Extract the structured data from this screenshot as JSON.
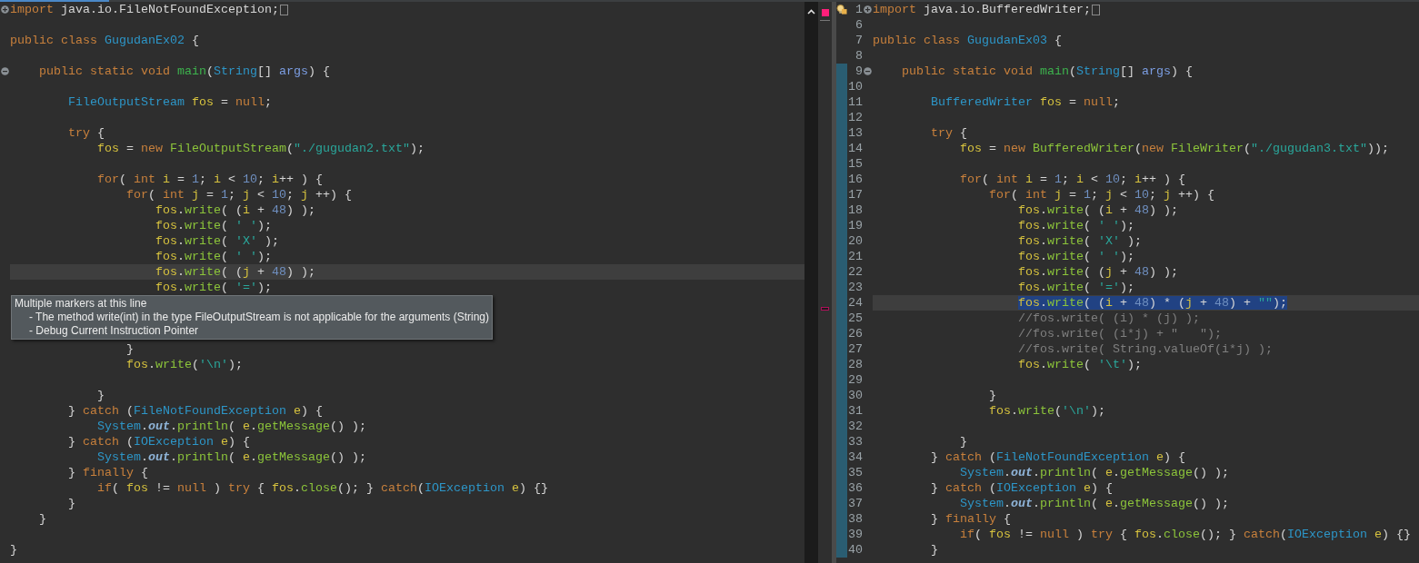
{
  "left_editor": {
    "tab": {
      "selected": true
    },
    "error_indicator": true,
    "lines": [
      {
        "kind": "code",
        "folded": true,
        "collapsed_block": true,
        "tokens": [
          {
            "text": "import",
            "kind": "keyword"
          },
          {
            "text": " java.io.FileNotFoundException;",
            "kind": "plain"
          }
        ]
      },
      {
        "kind": "blank"
      },
      {
        "kind": "code",
        "tokens": [
          {
            "text": "public class ",
            "kind": "keyword"
          },
          {
            "text": "GugudanEx02",
            "kind": "type"
          },
          {
            "text": " {",
            "kind": "plain"
          }
        ]
      },
      {
        "kind": "blank"
      },
      {
        "kind": "code",
        "folded": false,
        "tokens": [
          {
            "text": "    public static void ",
            "kind": "keyword"
          },
          {
            "text": "main",
            "kind": "main"
          },
          {
            "text": "(",
            "kind": "plain"
          },
          {
            "text": "String",
            "kind": "type"
          },
          {
            "text": "[] ",
            "kind": "plain"
          },
          {
            "text": "args",
            "kind": "param"
          },
          {
            "text": ") {",
            "kind": "plain"
          }
        ]
      },
      {
        "kind": "blank"
      },
      {
        "kind": "code",
        "tokens": [
          {
            "text": "        FileOutputStream ",
            "kind": "type"
          },
          {
            "text": "fos",
            "kind": "variable"
          },
          {
            "text": " = ",
            "kind": "plain"
          },
          {
            "text": "null",
            "kind": "keyword"
          },
          {
            "text": ";",
            "kind": "plain"
          }
        ]
      },
      {
        "kind": "blank"
      },
      {
        "kind": "code",
        "tokens": [
          {
            "text": "        try",
            "kind": "keyword"
          },
          {
            "text": " {",
            "kind": "plain"
          }
        ]
      },
      {
        "kind": "code",
        "tokens": [
          {
            "text": "            fos",
            "kind": "variable"
          },
          {
            "text": " = ",
            "kind": "plain"
          },
          {
            "text": "new ",
            "kind": "keyword"
          },
          {
            "text": "FileOutputStream",
            "kind": "method"
          },
          {
            "text": "(",
            "kind": "plain"
          },
          {
            "text": "\"./gugudan2.txt\"",
            "kind": "string"
          },
          {
            "text": ");",
            "kind": "plain"
          }
        ]
      },
      {
        "kind": "blank"
      },
      {
        "kind": "code",
        "tokens": [
          {
            "text": "            for",
            "kind": "keyword"
          },
          {
            "text": "( ",
            "kind": "plain"
          },
          {
            "text": "int ",
            "kind": "keyword"
          },
          {
            "text": "i",
            "kind": "variable"
          },
          {
            "text": " = ",
            "kind": "plain"
          },
          {
            "text": "1",
            "kind": "number"
          },
          {
            "text": "; ",
            "kind": "plain"
          },
          {
            "text": "i",
            "kind": "variable"
          },
          {
            "text": " < ",
            "kind": "plain"
          },
          {
            "text": "10",
            "kind": "number"
          },
          {
            "text": "; ",
            "kind": "plain"
          },
          {
            "text": "i",
            "kind": "variable"
          },
          {
            "text": "++ ) {",
            "kind": "plain"
          }
        ]
      },
      {
        "kind": "code",
        "tokens": [
          {
            "text": "                for",
            "kind": "keyword"
          },
          {
            "text": "( ",
            "kind": "plain"
          },
          {
            "text": "int ",
            "kind": "keyword"
          },
          {
            "text": "j",
            "kind": "variable"
          },
          {
            "text": " = ",
            "kind": "plain"
          },
          {
            "text": "1",
            "kind": "number"
          },
          {
            "text": "; ",
            "kind": "plain"
          },
          {
            "text": "j",
            "kind": "variable"
          },
          {
            "text": " < ",
            "kind": "plain"
          },
          {
            "text": "10",
            "kind": "number"
          },
          {
            "text": "; ",
            "kind": "plain"
          },
          {
            "text": "j",
            "kind": "variable"
          },
          {
            "text": " ++) {",
            "kind": "plain"
          }
        ]
      },
      {
        "kind": "code",
        "tokens": [
          {
            "text": "                    fos",
            "kind": "variable"
          },
          {
            "text": ".",
            "kind": "plain"
          },
          {
            "text": "write",
            "kind": "method"
          },
          {
            "text": "( (",
            "kind": "plain"
          },
          {
            "text": "i",
            "kind": "variable"
          },
          {
            "text": " + ",
            "kind": "plain"
          },
          {
            "text": "48",
            "kind": "number"
          },
          {
            "text": ") );",
            "kind": "plain"
          }
        ]
      },
      {
        "kind": "code",
        "tokens": [
          {
            "text": "                    fos",
            "kind": "variable"
          },
          {
            "text": ".",
            "kind": "plain"
          },
          {
            "text": "write",
            "kind": "method"
          },
          {
            "text": "( ",
            "kind": "plain"
          },
          {
            "text": "' '",
            "kind": "string"
          },
          {
            "text": ");",
            "kind": "plain"
          }
        ]
      },
      {
        "kind": "code",
        "tokens": [
          {
            "text": "                    fos",
            "kind": "variable"
          },
          {
            "text": ".",
            "kind": "plain"
          },
          {
            "text": "write",
            "kind": "method"
          },
          {
            "text": "( ",
            "kind": "plain"
          },
          {
            "text": "'X'",
            "kind": "string"
          },
          {
            "text": " );",
            "kind": "plain"
          }
        ]
      },
      {
        "kind": "code",
        "tokens": [
          {
            "text": "                    fos",
            "kind": "variable"
          },
          {
            "text": ".",
            "kind": "plain"
          },
          {
            "text": "write",
            "kind": "method"
          },
          {
            "text": "( ",
            "kind": "plain"
          },
          {
            "text": "' '",
            "kind": "string"
          },
          {
            "text": ");",
            "kind": "plain"
          }
        ]
      },
      {
        "kind": "code",
        "current": true,
        "tokens": [
          {
            "text": "                    fos",
            "kind": "variable"
          },
          {
            "text": ".",
            "kind": "plain"
          },
          {
            "text": "write",
            "kind": "method"
          },
          {
            "text": "( (",
            "kind": "plain"
          },
          {
            "text": "j",
            "kind": "variable"
          },
          {
            "text": " + ",
            "kind": "plain"
          },
          {
            "text": "48",
            "kind": "number"
          },
          {
            "text": ") );",
            "kind": "plain"
          }
        ]
      },
      {
        "kind": "code",
        "tokens": [
          {
            "text": "                    fos",
            "kind": "variable"
          },
          {
            "text": ".",
            "kind": "plain"
          },
          {
            "text": "write",
            "kind": "method"
          },
          {
            "text": "( ",
            "kind": "plain"
          },
          {
            "text": "'='",
            "kind": "string"
          },
          {
            "text": ");",
            "kind": "plain"
          }
        ]
      },
      {
        "kind": "blank",
        "error": true
      },
      {
        "kind": "blank"
      },
      {
        "kind": "blank"
      },
      {
        "kind": "code",
        "tokens": [
          {
            "text": "                }",
            "kind": "plain"
          }
        ]
      },
      {
        "kind": "code",
        "tokens": [
          {
            "text": "                fos",
            "kind": "variable"
          },
          {
            "text": ".",
            "kind": "plain"
          },
          {
            "text": "write",
            "kind": "method"
          },
          {
            "text": "(",
            "kind": "plain"
          },
          {
            "text": "'\\n'",
            "kind": "string"
          },
          {
            "text": ");",
            "kind": "plain"
          }
        ]
      },
      {
        "kind": "blank"
      },
      {
        "kind": "code",
        "tokens": [
          {
            "text": "            }",
            "kind": "plain"
          }
        ]
      },
      {
        "kind": "code",
        "tokens": [
          {
            "text": "        } ",
            "kind": "plain"
          },
          {
            "text": "catch",
            "kind": "keyword"
          },
          {
            "text": " (",
            "kind": "plain"
          },
          {
            "text": "FileNotFoundException ",
            "kind": "type"
          },
          {
            "text": "e",
            "kind": "variable"
          },
          {
            "text": ") {",
            "kind": "plain"
          }
        ]
      },
      {
        "kind": "code",
        "tokens": [
          {
            "text": "            System",
            "kind": "type"
          },
          {
            "text": ".",
            "kind": "plain"
          },
          {
            "text": "out",
            "kind": "field"
          },
          {
            "text": ".",
            "kind": "plain"
          },
          {
            "text": "println",
            "kind": "method"
          },
          {
            "text": "( ",
            "kind": "plain"
          },
          {
            "text": "e",
            "kind": "variable"
          },
          {
            "text": ".",
            "kind": "plain"
          },
          {
            "text": "getMessage",
            "kind": "method"
          },
          {
            "text": "() );",
            "kind": "plain"
          }
        ]
      },
      {
        "kind": "code",
        "tokens": [
          {
            "text": "        } ",
            "kind": "plain"
          },
          {
            "text": "catch",
            "kind": "keyword"
          },
          {
            "text": " (",
            "kind": "plain"
          },
          {
            "text": "IOException ",
            "kind": "type"
          },
          {
            "text": "e",
            "kind": "variable"
          },
          {
            "text": ") {",
            "kind": "plain"
          }
        ]
      },
      {
        "kind": "code",
        "tokens": [
          {
            "text": "            System",
            "kind": "type"
          },
          {
            "text": ".",
            "kind": "plain"
          },
          {
            "text": "out",
            "kind": "field"
          },
          {
            "text": ".",
            "kind": "plain"
          },
          {
            "text": "println",
            "kind": "method"
          },
          {
            "text": "( ",
            "kind": "plain"
          },
          {
            "text": "e",
            "kind": "variable"
          },
          {
            "text": ".",
            "kind": "plain"
          },
          {
            "text": "getMessage",
            "kind": "method"
          },
          {
            "text": "() );",
            "kind": "plain"
          }
        ]
      },
      {
        "kind": "code",
        "tokens": [
          {
            "text": "        } ",
            "kind": "plain"
          },
          {
            "text": "finally",
            "kind": "keyword"
          },
          {
            "text": " {",
            "kind": "plain"
          }
        ]
      },
      {
        "kind": "code",
        "tokens": [
          {
            "text": "            if",
            "kind": "keyword"
          },
          {
            "text": "( ",
            "kind": "plain"
          },
          {
            "text": "fos",
            "kind": "variable"
          },
          {
            "text": " != ",
            "kind": "plain"
          },
          {
            "text": "null",
            "kind": "keyword"
          },
          {
            "text": " ) ",
            "kind": "plain"
          },
          {
            "text": "try",
            "kind": "keyword"
          },
          {
            "text": " { ",
            "kind": "plain"
          },
          {
            "text": "fos",
            "kind": "variable"
          },
          {
            "text": ".",
            "kind": "plain"
          },
          {
            "text": "close",
            "kind": "method"
          },
          {
            "text": "(); } ",
            "kind": "plain"
          },
          {
            "text": "catch",
            "kind": "keyword"
          },
          {
            "text": "(",
            "kind": "plain"
          },
          {
            "text": "IOException ",
            "kind": "type"
          },
          {
            "text": "e",
            "kind": "variable"
          },
          {
            "text": ") {}",
            "kind": "plain"
          }
        ]
      },
      {
        "kind": "code",
        "tokens": [
          {
            "text": "        }",
            "kind": "plain"
          }
        ]
      },
      {
        "kind": "code",
        "tokens": [
          {
            "text": "    }",
            "kind": "plain"
          }
        ]
      },
      {
        "kind": "blank"
      },
      {
        "kind": "code",
        "tokens": [
          {
            "text": "}",
            "kind": "plain"
          }
        ]
      }
    ],
    "tooltip": {
      "title": "Multiple markers at this line",
      "items": [
        "- The method write(int) in the type FileOutputStream is not applicable for the arguments (String)",
        "- Debug Current Instruction Pointer"
      ]
    }
  },
  "right_editor": {
    "lines": [
      {
        "number": "1",
        "kind": "code",
        "warning": true,
        "folded": true,
        "collapsed_block": true,
        "tokens": [
          {
            "text": "import",
            "kind": "keyword"
          },
          {
            "text": " java.io.BufferedWriter;",
            "kind": "plain"
          }
        ]
      },
      {
        "number": "6",
        "kind": "blank"
      },
      {
        "number": "7",
        "kind": "code",
        "tokens": [
          {
            "text": "public class ",
            "kind": "keyword"
          },
          {
            "text": "GugudanEx03",
            "kind": "type"
          },
          {
            "text": " {",
            "kind": "plain"
          }
        ]
      },
      {
        "number": "8",
        "kind": "blank"
      },
      {
        "number": "9",
        "kind": "code",
        "changed": true,
        "folded": false,
        "tokens": [
          {
            "text": "    public static void ",
            "kind": "keyword"
          },
          {
            "text": "main",
            "kind": "main"
          },
          {
            "text": "(",
            "kind": "plain"
          },
          {
            "text": "String",
            "kind": "type"
          },
          {
            "text": "[] ",
            "kind": "plain"
          },
          {
            "text": "args",
            "kind": "param"
          },
          {
            "text": ") {",
            "kind": "plain"
          }
        ]
      },
      {
        "number": "10",
        "kind": "blank",
        "changed": true
      },
      {
        "number": "11",
        "kind": "code",
        "changed": true,
        "tokens": [
          {
            "text": "        BufferedWriter ",
            "kind": "type"
          },
          {
            "text": "fos",
            "kind": "variable"
          },
          {
            "text": " = ",
            "kind": "plain"
          },
          {
            "text": "null",
            "kind": "keyword"
          },
          {
            "text": ";",
            "kind": "plain"
          }
        ]
      },
      {
        "number": "12",
        "kind": "blank",
        "changed": true
      },
      {
        "number": "13",
        "kind": "code",
        "changed": true,
        "tokens": [
          {
            "text": "        try",
            "kind": "keyword"
          },
          {
            "text": " {",
            "kind": "plain"
          }
        ]
      },
      {
        "number": "14",
        "kind": "code",
        "changed": true,
        "tokens": [
          {
            "text": "            fos",
            "kind": "variable"
          },
          {
            "text": " = ",
            "kind": "plain"
          },
          {
            "text": "new ",
            "kind": "keyword"
          },
          {
            "text": "BufferedWriter",
            "kind": "method"
          },
          {
            "text": "(",
            "kind": "plain"
          },
          {
            "text": "new ",
            "kind": "keyword"
          },
          {
            "text": "FileWriter",
            "kind": "method"
          },
          {
            "text": "(",
            "kind": "plain"
          },
          {
            "text": "\"./gugudan3.txt\"",
            "kind": "string"
          },
          {
            "text": "));",
            "kind": "plain"
          }
        ]
      },
      {
        "number": "15",
        "kind": "blank",
        "changed": true
      },
      {
        "number": "16",
        "kind": "code",
        "changed": true,
        "tokens": [
          {
            "text": "            for",
            "kind": "keyword"
          },
          {
            "text": "( ",
            "kind": "plain"
          },
          {
            "text": "int ",
            "kind": "keyword"
          },
          {
            "text": "i",
            "kind": "variable"
          },
          {
            "text": " = ",
            "kind": "plain"
          },
          {
            "text": "1",
            "kind": "number"
          },
          {
            "text": "; ",
            "kind": "plain"
          },
          {
            "text": "i",
            "kind": "variable"
          },
          {
            "text": " < ",
            "kind": "plain"
          },
          {
            "text": "10",
            "kind": "number"
          },
          {
            "text": "; ",
            "kind": "plain"
          },
          {
            "text": "i",
            "kind": "variable"
          },
          {
            "text": "++ ) {",
            "kind": "plain"
          }
        ]
      },
      {
        "number": "17",
        "kind": "code",
        "changed": true,
        "tokens": [
          {
            "text": "                for",
            "kind": "keyword"
          },
          {
            "text": "( ",
            "kind": "plain"
          },
          {
            "text": "int ",
            "kind": "keyword"
          },
          {
            "text": "j",
            "kind": "variable"
          },
          {
            "text": " = ",
            "kind": "plain"
          },
          {
            "text": "1",
            "kind": "number"
          },
          {
            "text": "; ",
            "kind": "plain"
          },
          {
            "text": "j",
            "kind": "variable"
          },
          {
            "text": " < ",
            "kind": "plain"
          },
          {
            "text": "10",
            "kind": "number"
          },
          {
            "text": "; ",
            "kind": "plain"
          },
          {
            "text": "j",
            "kind": "variable"
          },
          {
            "text": " ++) {",
            "kind": "plain"
          }
        ]
      },
      {
        "number": "18",
        "kind": "code",
        "changed": true,
        "tokens": [
          {
            "text": "                    fos",
            "kind": "variable"
          },
          {
            "text": ".",
            "kind": "plain"
          },
          {
            "text": "write",
            "kind": "method"
          },
          {
            "text": "( (",
            "kind": "plain"
          },
          {
            "text": "i",
            "kind": "variable"
          },
          {
            "text": " + ",
            "kind": "plain"
          },
          {
            "text": "48",
            "kind": "number"
          },
          {
            "text": ") );",
            "kind": "plain"
          }
        ]
      },
      {
        "number": "19",
        "kind": "code",
        "changed": true,
        "tokens": [
          {
            "text": "                    fos",
            "kind": "variable"
          },
          {
            "text": ".",
            "kind": "plain"
          },
          {
            "text": "write",
            "kind": "method"
          },
          {
            "text": "( ",
            "kind": "plain"
          },
          {
            "text": "' '",
            "kind": "string"
          },
          {
            "text": ");",
            "kind": "plain"
          }
        ]
      },
      {
        "number": "20",
        "kind": "code",
        "changed": true,
        "tokens": [
          {
            "text": "                    fos",
            "kind": "variable"
          },
          {
            "text": ".",
            "kind": "plain"
          },
          {
            "text": "write",
            "kind": "method"
          },
          {
            "text": "( ",
            "kind": "plain"
          },
          {
            "text": "'X'",
            "kind": "string"
          },
          {
            "text": " );",
            "kind": "plain"
          }
        ]
      },
      {
        "number": "21",
        "kind": "code",
        "changed": true,
        "tokens": [
          {
            "text": "                    fos",
            "kind": "variable"
          },
          {
            "text": ".",
            "kind": "plain"
          },
          {
            "text": "write",
            "kind": "method"
          },
          {
            "text": "( ",
            "kind": "plain"
          },
          {
            "text": "' '",
            "kind": "string"
          },
          {
            "text": ");",
            "kind": "plain"
          }
        ]
      },
      {
        "number": "22",
        "kind": "code",
        "changed": true,
        "tokens": [
          {
            "text": "                    fos",
            "kind": "variable"
          },
          {
            "text": ".",
            "kind": "plain"
          },
          {
            "text": "write",
            "kind": "method"
          },
          {
            "text": "( (",
            "kind": "plain"
          },
          {
            "text": "j",
            "kind": "variable"
          },
          {
            "text": " + ",
            "kind": "plain"
          },
          {
            "text": "48",
            "kind": "number"
          },
          {
            "text": ") );",
            "kind": "plain"
          }
        ]
      },
      {
        "number": "23",
        "kind": "code",
        "changed": true,
        "tokens": [
          {
            "text": "                    fos",
            "kind": "variable"
          },
          {
            "text": ".",
            "kind": "plain"
          },
          {
            "text": "write",
            "kind": "method"
          },
          {
            "text": "( ",
            "kind": "plain"
          },
          {
            "text": "'='",
            "kind": "string"
          },
          {
            "text": ");",
            "kind": "plain"
          }
        ]
      },
      {
        "number": "24",
        "kind": "code",
        "current": true,
        "selected": true,
        "changed": true,
        "tokens": [
          {
            "text": "                    fos",
            "kind": "variable"
          },
          {
            "text": ".",
            "kind": "plain"
          },
          {
            "text": "write",
            "kind": "method"
          },
          {
            "text": "( (",
            "kind": "plain"
          },
          {
            "text": "i",
            "kind": "variable"
          },
          {
            "text": " + ",
            "kind": "plain"
          },
          {
            "text": "48",
            "kind": "number"
          },
          {
            "text": ") * (",
            "kind": "plain"
          },
          {
            "text": "j",
            "kind": "variable"
          },
          {
            "text": " + ",
            "kind": "plain"
          },
          {
            "text": "48",
            "kind": "number"
          },
          {
            "text": ") + ",
            "kind": "plain"
          },
          {
            "text": "\"\"",
            "kind": "string"
          },
          {
            "text": ");",
            "kind": "plain"
          }
        ]
      },
      {
        "number": "25",
        "kind": "code",
        "changed": true,
        "tokens": [
          {
            "text": "                    //fos.write( (i) * (j) );",
            "kind": "comment"
          }
        ]
      },
      {
        "number": "26",
        "kind": "code",
        "changed": true,
        "tokens": [
          {
            "text": "                    //fos.write( (i*j) + \"   \");",
            "kind": "comment"
          }
        ]
      },
      {
        "number": "27",
        "kind": "code",
        "changed": true,
        "tokens": [
          {
            "text": "                    //fos.write( String.valueOf(i*j) );",
            "kind": "comment"
          }
        ]
      },
      {
        "number": "28",
        "kind": "code",
        "changed": true,
        "tokens": [
          {
            "text": "                    fos",
            "kind": "variable"
          },
          {
            "text": ".",
            "kind": "plain"
          },
          {
            "text": "write",
            "kind": "method"
          },
          {
            "text": "( ",
            "kind": "plain"
          },
          {
            "text": "'\\t'",
            "kind": "string"
          },
          {
            "text": ");",
            "kind": "plain"
          }
        ]
      },
      {
        "number": "29",
        "kind": "blank",
        "changed": true
      },
      {
        "number": "30",
        "kind": "code",
        "changed": true,
        "tokens": [
          {
            "text": "                }",
            "kind": "plain"
          }
        ]
      },
      {
        "number": "31",
        "kind": "code",
        "changed": true,
        "tokens": [
          {
            "text": "                fos",
            "kind": "variable"
          },
          {
            "text": ".",
            "kind": "plain"
          },
          {
            "text": "write",
            "kind": "method"
          },
          {
            "text": "(",
            "kind": "plain"
          },
          {
            "text": "'\\n'",
            "kind": "string"
          },
          {
            "text": ");",
            "kind": "plain"
          }
        ]
      },
      {
        "number": "32",
        "kind": "blank",
        "changed": true
      },
      {
        "number": "33",
        "kind": "code",
        "changed": true,
        "tokens": [
          {
            "text": "            }",
            "kind": "plain"
          }
        ]
      },
      {
        "number": "34",
        "kind": "code",
        "changed": true,
        "tokens": [
          {
            "text": "        } ",
            "kind": "plain"
          },
          {
            "text": "catch",
            "kind": "keyword"
          },
          {
            "text": " (",
            "kind": "plain"
          },
          {
            "text": "FileNotFoundException ",
            "kind": "type"
          },
          {
            "text": "e",
            "kind": "variable"
          },
          {
            "text": ") {",
            "kind": "plain"
          }
        ]
      },
      {
        "number": "35",
        "kind": "code",
        "changed": true,
        "tokens": [
          {
            "text": "            System",
            "kind": "type"
          },
          {
            "text": ".",
            "kind": "plain"
          },
          {
            "text": "out",
            "kind": "field"
          },
          {
            "text": ".",
            "kind": "plain"
          },
          {
            "text": "println",
            "kind": "method"
          },
          {
            "text": "( ",
            "kind": "plain"
          },
          {
            "text": "e",
            "kind": "variable"
          },
          {
            "text": ".",
            "kind": "plain"
          },
          {
            "text": "getMessage",
            "kind": "method"
          },
          {
            "text": "() );",
            "kind": "plain"
          }
        ]
      },
      {
        "number": "36",
        "kind": "code",
        "changed": true,
        "tokens": [
          {
            "text": "        } ",
            "kind": "plain"
          },
          {
            "text": "catch",
            "kind": "keyword"
          },
          {
            "text": " (",
            "kind": "plain"
          },
          {
            "text": "IOException ",
            "kind": "type"
          },
          {
            "text": "e",
            "kind": "variable"
          },
          {
            "text": ") {",
            "kind": "plain"
          }
        ]
      },
      {
        "number": "37",
        "kind": "code",
        "changed": true,
        "tokens": [
          {
            "text": "            System",
            "kind": "type"
          },
          {
            "text": ".",
            "kind": "plain"
          },
          {
            "text": "out",
            "kind": "field"
          },
          {
            "text": ".",
            "kind": "plain"
          },
          {
            "text": "println",
            "kind": "method"
          },
          {
            "text": "( ",
            "kind": "plain"
          },
          {
            "text": "e",
            "kind": "variable"
          },
          {
            "text": ".",
            "kind": "plain"
          },
          {
            "text": "getMessage",
            "kind": "method"
          },
          {
            "text": "() );",
            "kind": "plain"
          }
        ]
      },
      {
        "number": "38",
        "kind": "code",
        "changed": true,
        "tokens": [
          {
            "text": "        } ",
            "kind": "plain"
          },
          {
            "text": "finally",
            "kind": "keyword"
          },
          {
            "text": " {",
            "kind": "plain"
          }
        ]
      },
      {
        "number": "39",
        "kind": "code",
        "changed": true,
        "tokens": [
          {
            "text": "            if",
            "kind": "keyword"
          },
          {
            "text": "( ",
            "kind": "plain"
          },
          {
            "text": "fos",
            "kind": "variable"
          },
          {
            "text": " != ",
            "kind": "plain"
          },
          {
            "text": "null",
            "kind": "keyword"
          },
          {
            "text": " ) ",
            "kind": "plain"
          },
          {
            "text": "try",
            "kind": "keyword"
          },
          {
            "text": " { ",
            "kind": "plain"
          },
          {
            "text": "fos",
            "kind": "variable"
          },
          {
            "text": ".",
            "kind": "plain"
          },
          {
            "text": "close",
            "kind": "method"
          },
          {
            "text": "(); } ",
            "kind": "plain"
          },
          {
            "text": "catch",
            "kind": "keyword"
          },
          {
            "text": "(",
            "kind": "plain"
          },
          {
            "text": "IOException ",
            "kind": "type"
          },
          {
            "text": "e",
            "kind": "variable"
          },
          {
            "text": ") {}",
            "kind": "plain"
          }
        ]
      },
      {
        "number": "40",
        "kind": "code",
        "changed": true,
        "tokens": [
          {
            "text": "        }",
            "kind": "plain"
          }
        ]
      }
    ]
  }
}
